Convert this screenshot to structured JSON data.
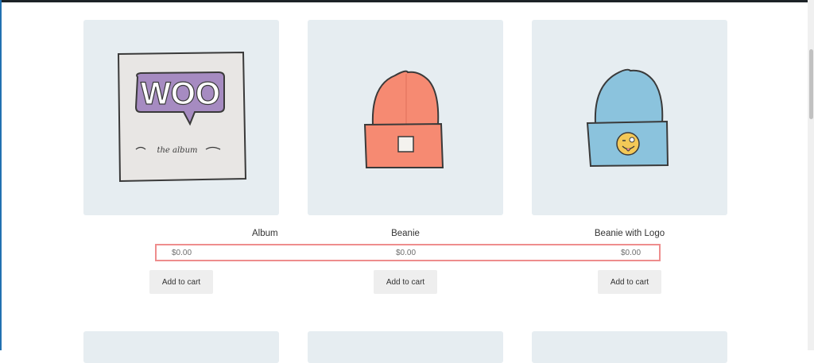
{
  "products": [
    {
      "title": "Album",
      "price": "$0.00",
      "button_label": "Add to cart",
      "image_name": "woo-album-cover",
      "image_text": {
        "brand": "WOO",
        "subtitle": "the album"
      }
    },
    {
      "title": "Beanie",
      "price": "$0.00",
      "button_label": "Add to cart",
      "image_name": "orange-beanie"
    },
    {
      "title": "Beanie with Logo",
      "price": "$0.00",
      "button_label": "Add to cart",
      "image_name": "blue-beanie-with-logo"
    }
  ],
  "colors": {
    "thumbnail_bg": "#e6edf1",
    "highlight_border": "#ee8d8d",
    "button_bg": "#eeeeee",
    "album_purple": "#a68bc1",
    "beanie_orange": "#f68a72",
    "beanie_blue": "#8bc3dd"
  }
}
